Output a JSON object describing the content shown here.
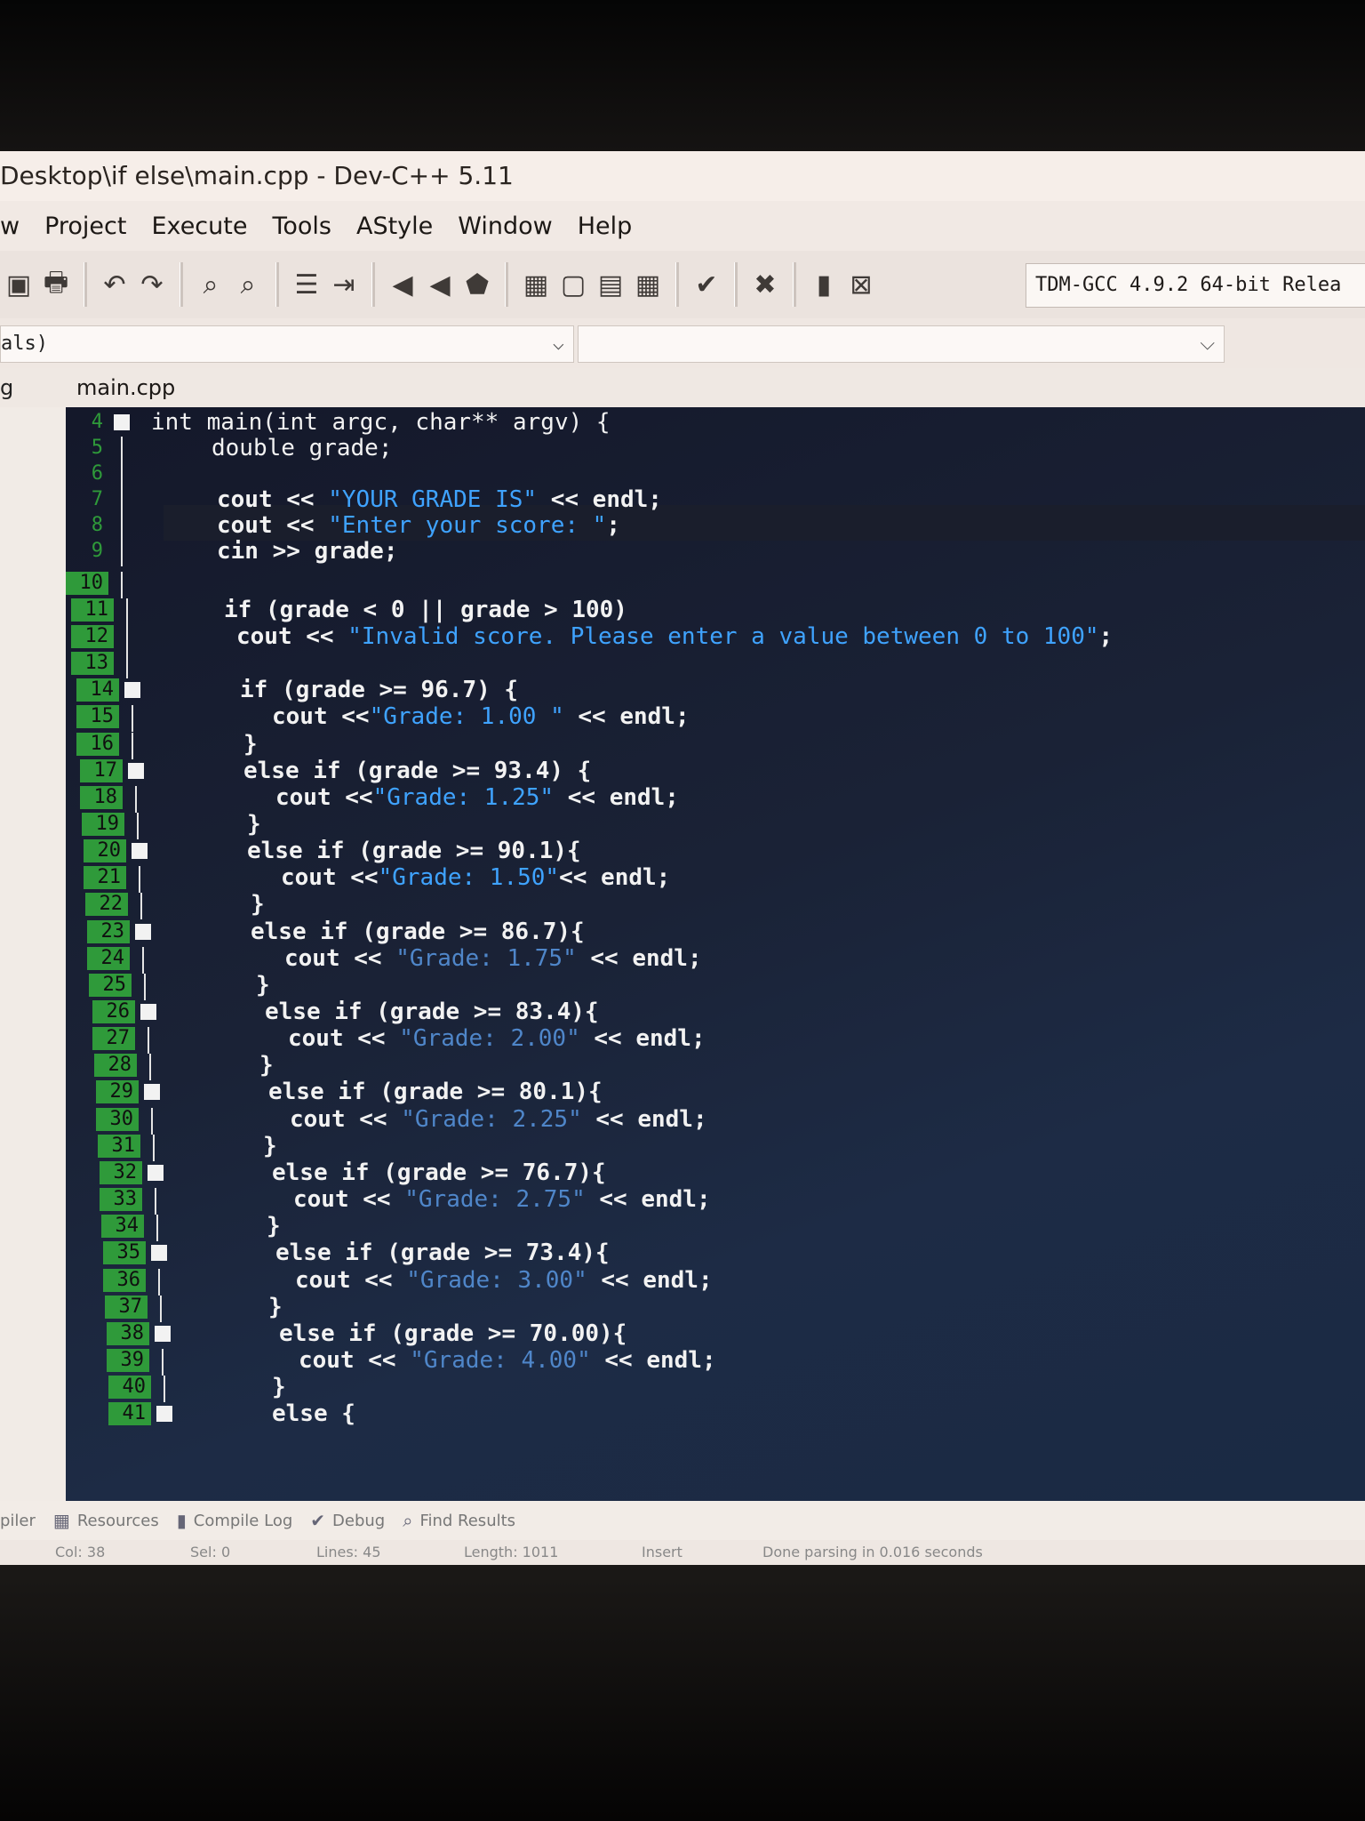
{
  "window": {
    "title": "Desktop\\if else\\main.cpp - Dev-C++ 5.11"
  },
  "menu": [
    "w",
    "Project",
    "Execute",
    "Tools",
    "AStyle",
    "Window",
    "Help"
  ],
  "toolbar": {
    "compiler": "TDM-GCC 4.9.2 64-bit Relea"
  },
  "class_select": {
    "value": "als)"
  },
  "tabs": {
    "left_label": "g",
    "file_tab": "main.cpp"
  },
  "editor": {
    "lines": [
      {
        "n": "4",
        "text": "int main(int argc, char** argv) {"
      },
      {
        "n": "5",
        "text": "double grade;"
      },
      {
        "n": "6",
        "text": ""
      },
      {
        "n": "7",
        "pre": "cout << ",
        "str": "\"YOUR GRADE IS\"",
        "post": " << endl;"
      },
      {
        "n": "8",
        "pre": "cout << ",
        "str": "\"Enter your score: \"",
        "post": ";"
      },
      {
        "n": "9",
        "text": "cin >> grade;"
      },
      {
        "n": "10",
        "text": ""
      },
      {
        "n": "11",
        "text": "if (grade < 0 || grade > 100)"
      },
      {
        "n": "12",
        "pre": "cout << ",
        "str": "\"Invalid score. Please enter a value between 0 to 100\"",
        "post": ";"
      },
      {
        "n": "13",
        "text": ""
      },
      {
        "n": "14",
        "text": "if (grade >= 96.7) {"
      },
      {
        "n": "15",
        "pre": "cout <<",
        "str": "\"Grade: 1.00 \"",
        "post": " << endl;"
      },
      {
        "n": "16",
        "text": "}"
      },
      {
        "n": "17",
        "text": "else if (grade >= 93.4) {"
      },
      {
        "n": "18",
        "pre": "cout <<",
        "str": "\"Grade: 1.25\"",
        "post": " << endl;"
      },
      {
        "n": "19",
        "text": "}"
      },
      {
        "n": "20",
        "text": "else if (grade >= 90.1){"
      },
      {
        "n": "21",
        "pre": "cout <<",
        "str": "\"Grade: 1.50\"",
        "post": "<< endl;"
      },
      {
        "n": "22",
        "text": "}"
      },
      {
        "n": "23",
        "text": "else if (grade >= 86.7){"
      },
      {
        "n": "24",
        "pre": "cout << ",
        "str": "\"Grade: 1.75\"",
        "post": " << endl;"
      },
      {
        "n": "25",
        "text": "}"
      },
      {
        "n": "26",
        "text": "else if (grade >= 83.4){"
      },
      {
        "n": "27",
        "pre": "cout << ",
        "str": "\"Grade: 2.00\"",
        "post": " << endl;"
      },
      {
        "n": "28",
        "text": "}"
      },
      {
        "n": "29",
        "text": "else if (grade >= 80.1){"
      },
      {
        "n": "30",
        "pre": "cout << ",
        "str": "\"Grade: 2.25\"",
        "post": " << endl;"
      },
      {
        "n": "31",
        "text": "}"
      },
      {
        "n": "32",
        "text": "else if (grade >= 76.7){"
      },
      {
        "n": "33",
        "pre": "cout << ",
        "str": "\"Grade: 2.75\"",
        "post": " << endl;"
      },
      {
        "n": "34",
        "text": "}"
      },
      {
        "n": "35",
        "text": "else if (grade >= 73.4){"
      },
      {
        "n": "36",
        "pre": "cout << ",
        "str": "\"Grade: 3.00\"",
        "post": " << endl;"
      },
      {
        "n": "37",
        "text": "}"
      },
      {
        "n": "38",
        "text": "else if (grade >= 70.00){"
      },
      {
        "n": "39",
        "pre": "cout << ",
        "str": "\"Grade: 4.00\"",
        "post": " << endl;"
      },
      {
        "n": "40",
        "text": "}"
      },
      {
        "n": "41",
        "text": "else {"
      }
    ]
  },
  "bottom_tabs": [
    "piler",
    "Resources",
    "Compile Log",
    "Debug",
    "Find Results"
  ],
  "status": {
    "col_label": "Col:",
    "col": "38",
    "sel_label": "Sel:",
    "sel": "0",
    "lines_label": "Lines:",
    "lines": "45",
    "length_label": "Length:",
    "length": "1011",
    "mode": "Insert",
    "message": "Done parsing in 0.016 seconds"
  },
  "colors": {
    "string": "#3fa3ff",
    "line_number_bg": "#2f9a3a",
    "editor_bg": "#1a2236"
  }
}
